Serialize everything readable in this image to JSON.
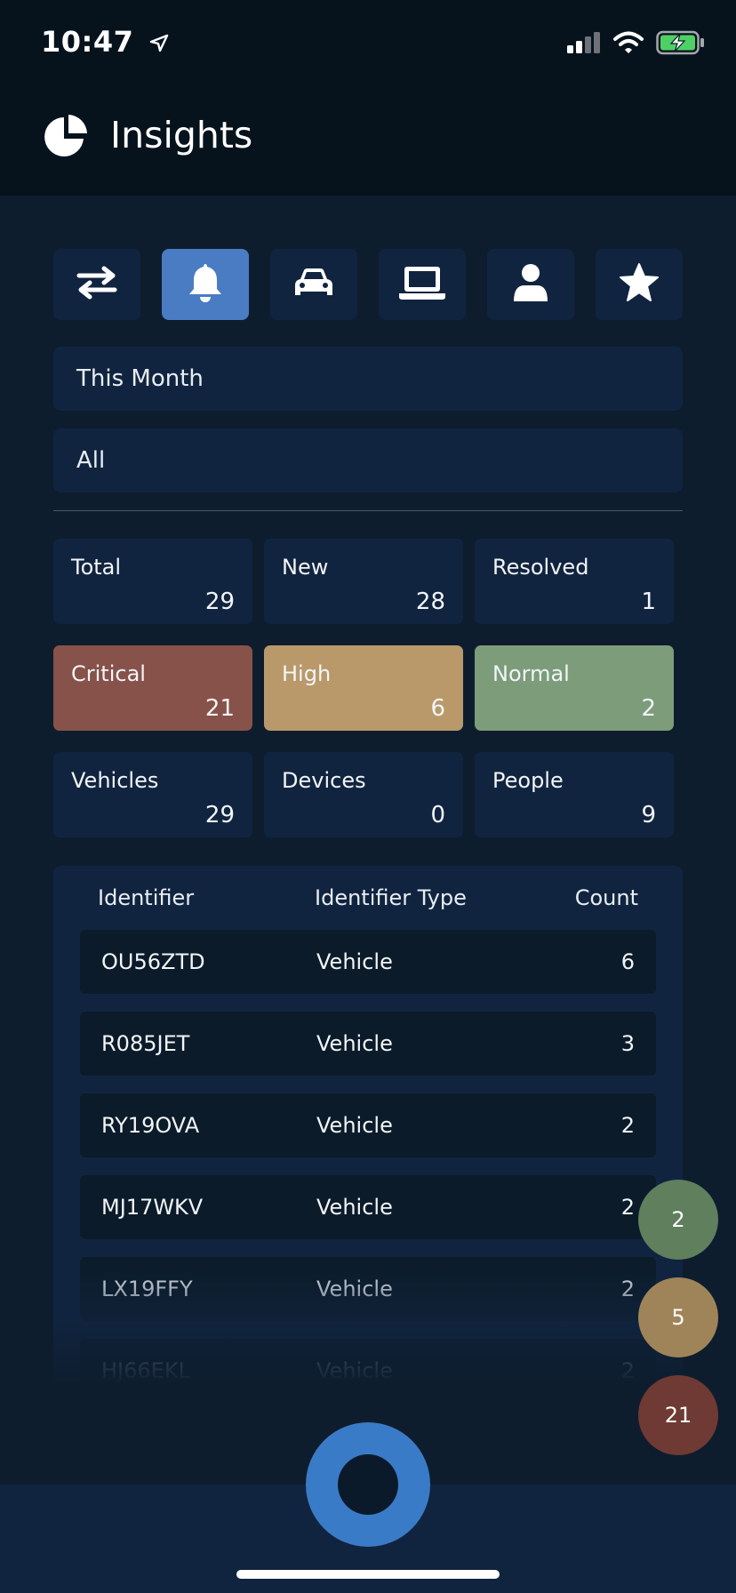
{
  "status_bar": {
    "time": "10:47"
  },
  "header": {
    "title": "Insights"
  },
  "tabs": [
    {
      "icon": "transfer-arrows-icon",
      "active": false
    },
    {
      "icon": "bell-icon",
      "active": true
    },
    {
      "icon": "car-icon",
      "active": false
    },
    {
      "icon": "laptop-icon",
      "active": false
    },
    {
      "icon": "user-icon",
      "active": false
    },
    {
      "icon": "star-icon",
      "active": false
    }
  ],
  "filters": {
    "period": "This Month",
    "scope": "All"
  },
  "stats": {
    "total": {
      "label": "Total",
      "value": "29"
    },
    "new": {
      "label": "New",
      "value": "28"
    },
    "resolved": {
      "label": "Resolved",
      "value": "1"
    },
    "critical": {
      "label": "Critical",
      "value": "21",
      "color": "#87524a"
    },
    "high": {
      "label": "High",
      "value": "6",
      "color": "#b9996a"
    },
    "normal": {
      "label": "Normal",
      "value": "2",
      "color": "#7c9c7a"
    },
    "vehicles": {
      "label": "Vehicles",
      "value": "29"
    },
    "devices": {
      "label": "Devices",
      "value": "0"
    },
    "people": {
      "label": "People",
      "value": "9"
    }
  },
  "table": {
    "headers": {
      "identifier": "Identifier",
      "type": "Identifier Type",
      "count": "Count"
    },
    "rows": [
      {
        "identifier": "OU56ZTD",
        "type": "Vehicle",
        "count": "6"
      },
      {
        "identifier": "R085JET",
        "type": "Vehicle",
        "count": "3"
      },
      {
        "identifier": "RY19OVA",
        "type": "Vehicle",
        "count": "2"
      },
      {
        "identifier": "MJ17WKV",
        "type": "Vehicle",
        "count": "2"
      },
      {
        "identifier": "LX19FFY",
        "type": "Vehicle",
        "count": "2"
      },
      {
        "identifier": "HJ66EKL",
        "type": "Vehicle",
        "count": "2"
      }
    ]
  },
  "floating_counts": {
    "normal": {
      "value": "2",
      "color": "#5f7f5d"
    },
    "high": {
      "value": "5",
      "color": "#a08459"
    },
    "critical": {
      "value": "21",
      "color": "#6e3a33"
    }
  }
}
